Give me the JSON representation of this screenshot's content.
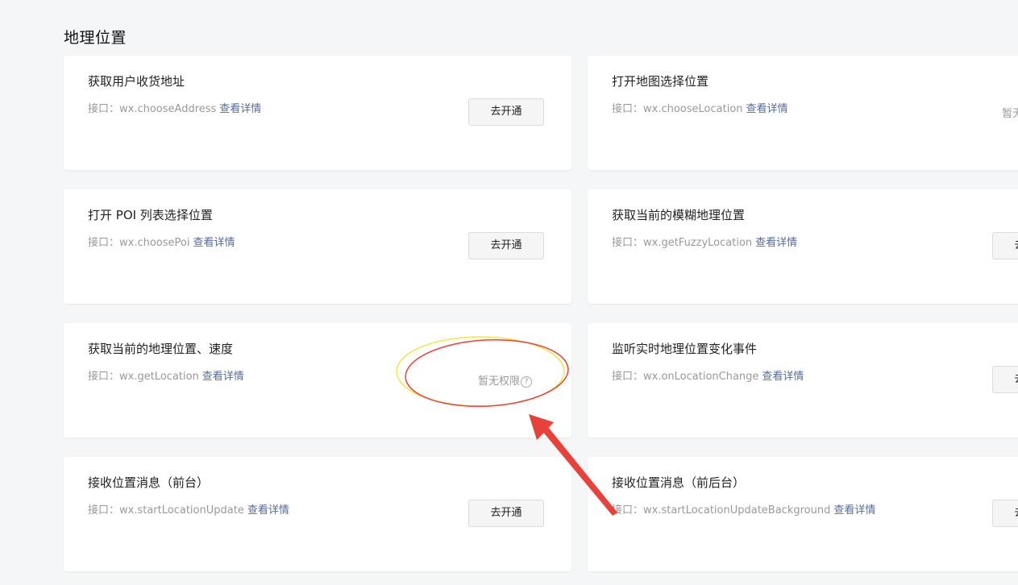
{
  "section": {
    "title": "地理位置"
  },
  "cards": [
    {
      "title": "获取用户收货地址",
      "api": "接口：wx.chooseAddress",
      "link": "查看详情",
      "action": "去开通"
    },
    {
      "title": "打开地图选择位置",
      "api": "接口：wx.chooseLocation",
      "link": "查看详情",
      "status": "暂无权限"
    },
    {
      "title": "打开 POI 列表选择位置",
      "api": "接口：wx.choosePoi",
      "link": "查看详情",
      "action": "去开通"
    },
    {
      "title": "获取当前的模糊地理位置",
      "api": "接口：wx.getFuzzyLocation",
      "link": "查看详情",
      "action": "去开通"
    },
    {
      "title": "获取当前的地理位置、速度",
      "api": "接口：wx.getLocation",
      "link": "查看详情",
      "status": "暂无权限"
    },
    {
      "title": "监听实时地理位置变化事件",
      "api": "接口：wx.onLocationChange",
      "link": "查看详情",
      "action": "去开通"
    },
    {
      "title": "接收位置消息（前台）",
      "api": "接口：wx.startLocationUpdate",
      "link": "查看详情",
      "action": "去开通"
    },
    {
      "title": "接收位置消息（前后台）",
      "api": "接口：wx.startLocationUpdateBackground",
      "link": "查看详情",
      "action": "去开通"
    }
  ],
  "icons": {
    "help": "question-circle-icon",
    "annotation_arrow": "red-arrow-icon"
  },
  "colors": {
    "link": "#576b95",
    "annotation_red": "#e8413a",
    "annotation_yellow": "#f2e64a",
    "page_bg": "#f5f6f7"
  }
}
